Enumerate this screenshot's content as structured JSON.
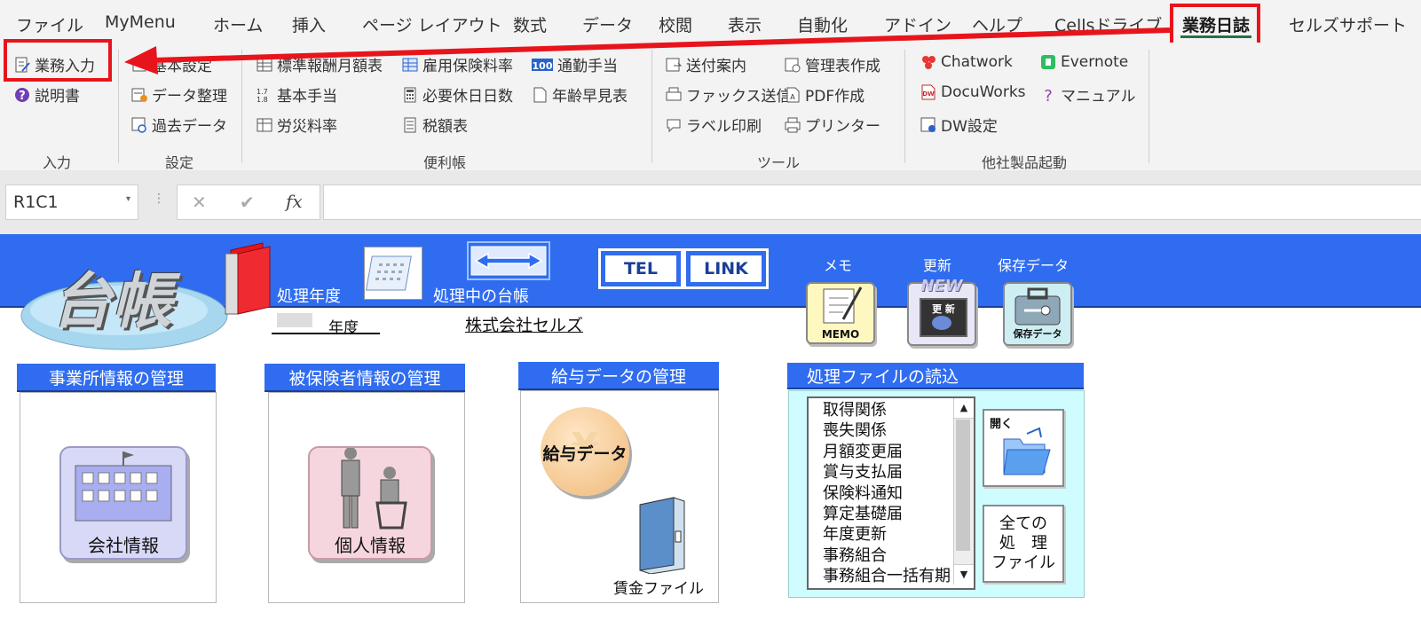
{
  "tabs": [
    {
      "id": "file",
      "label": "ファイル"
    },
    {
      "id": "mymenu",
      "label": "MyMenu"
    },
    {
      "id": "home",
      "label": "ホーム"
    },
    {
      "id": "insert",
      "label": "挿入"
    },
    {
      "id": "pagelayout",
      "label": "ページ レイアウト"
    },
    {
      "id": "formulas",
      "label": "数式"
    },
    {
      "id": "data",
      "label": "データ"
    },
    {
      "id": "review",
      "label": "校閲"
    },
    {
      "id": "view",
      "label": "表示"
    },
    {
      "id": "automate",
      "label": "自動化"
    },
    {
      "id": "addins",
      "label": "アドイン"
    },
    {
      "id": "help",
      "label": "ヘルプ"
    },
    {
      "id": "cellsdrive",
      "label": "Cellsドライブ"
    },
    {
      "id": "gyomu",
      "label": "業務日誌"
    },
    {
      "id": "support",
      "label": "セルズサポート"
    }
  ],
  "ribbon": {
    "input": {
      "gyomu_nyuryoku": "業務入力",
      "setsumei": "説明書",
      "group": "入力"
    },
    "settings": {
      "kihon": "基本設定",
      "data_seiri": "データ整理",
      "kako": "過去データ",
      "group": "設定"
    },
    "handbook": {
      "hyojun": "標準報酬月額表",
      "koyo": "雇用保険料率",
      "tsukin": "通勤手当",
      "kihon_teate": "基本手当",
      "hitsuyo": "必要休日日数",
      "nenrei": "年齢早見表",
      "rosai": "労災料率",
      "zeigaku": "税額表",
      "group": "便利帳"
    },
    "tools": {
      "soufu": "送付案内",
      "kanri": "管理表作成",
      "fax": "ファックス送信",
      "pdf": "PDF作成",
      "label": "ラベル印刷",
      "printer": "プリンター",
      "group": "ツール"
    },
    "other": {
      "chatwork": "Chatwork",
      "evernote": "Evernote",
      "docuworks": "DocuWorks",
      "manual": "マニュアル",
      "dw": "DW設定",
      "group": "他社製品起動"
    }
  },
  "formula_bar": {
    "name_box": "R1C1",
    "cancel": "✕",
    "enter": "✔",
    "fx": "fx"
  },
  "sheet": {
    "logo": "台帳",
    "year_label": "処理年度",
    "year_value": "年度",
    "current_ledger_label": "処理中の台帳",
    "company": "株式会社セルズ",
    "tel": "TEL",
    "link": "LINK",
    "memo_label": "メモ",
    "memo_icon_text": "MEMO",
    "update_label": "更新",
    "update_icon_new": "NEW",
    "update_icon_text": "更 新",
    "saved_label": "保存データ",
    "saved_icon_text": "保存データ",
    "panels": {
      "office": {
        "title": "事業所情報の管理",
        "button": "会社情報"
      },
      "insured": {
        "title": "被保険者情報の管理",
        "button": "個人情報"
      },
      "salary": {
        "title": "給与データの管理",
        "button": "給与データ",
        "file": "賃金ファイル"
      },
      "files": {
        "title": "処理ファイルの読込",
        "items": [
          "取得関係",
          "喪失関係",
          "月額変更届",
          "賞与支払届",
          "保険料通知",
          "算定基礎届",
          "年度更新",
          "事務組合",
          "事務組合一括有期"
        ],
        "open": "開く",
        "all_files": [
          "全ての",
          "処　理",
          "ファイル"
        ]
      }
    }
  },
  "colors": {
    "accent_red": "#e8141c",
    "sheet_blue": "#2f6cf0",
    "active_tab_underline": "#217346"
  }
}
